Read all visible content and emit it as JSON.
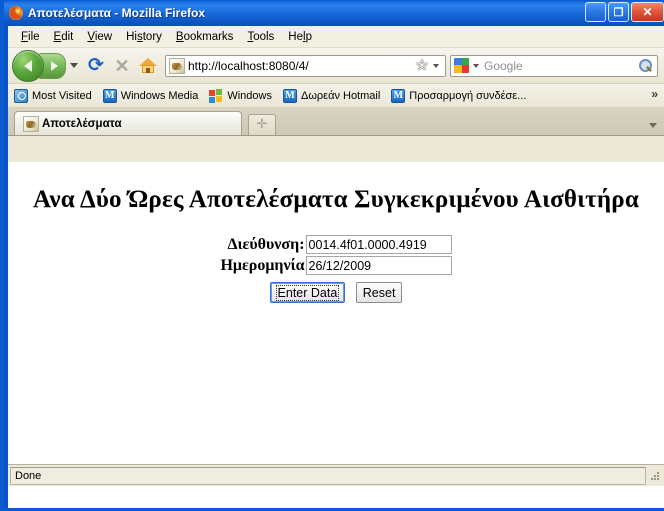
{
  "window": {
    "title": "Αποτελέσματα - Mozilla Firefox",
    "app_icon": "firefox-icon",
    "controls": {
      "minimize": "_",
      "maximize": "❐",
      "close": "✕"
    }
  },
  "menubar": {
    "items": [
      {
        "accel": "F",
        "rest": "ile"
      },
      {
        "accel": "E",
        "rest": "dit"
      },
      {
        "accel": "V",
        "rest": "iew"
      },
      {
        "pre": "Hi",
        "accel": "s",
        "rest": "tory"
      },
      {
        "accel": "B",
        "rest": "ookmarks"
      },
      {
        "accel": "T",
        "rest": "ools"
      },
      {
        "pre": "He",
        "accel": "l",
        "rest": "p"
      }
    ]
  },
  "navbar": {
    "back_tooltip": "Back",
    "forward_tooltip": "Forward",
    "reload_glyph": "⟳",
    "stop_glyph": "✕",
    "url": "http://localhost:8080/4/",
    "star_glyph": "☆",
    "search_placeholder": "Google"
  },
  "bookmarks": {
    "items": [
      {
        "label": "Most Visited",
        "icon": "most-visited-icon"
      },
      {
        "label": "Windows Media",
        "icon": "msn-icon"
      },
      {
        "label": "Windows",
        "icon": "windows-flag-icon"
      },
      {
        "label": "Δωρεάν Hotmail",
        "icon": "msn-icon"
      },
      {
        "label": "Προσαρμογή συνδέσε...",
        "icon": "msn-icon"
      }
    ],
    "overflow": "»"
  },
  "tabs": {
    "items": [
      {
        "label": "Αποτελέσματα",
        "favicon": "page-favicon"
      }
    ],
    "new_tab_glyph": "✛"
  },
  "page": {
    "heading": "Ανα Δύο Ώρες Αποτελέσματα Συγκεκριμένου Αισθιτήρα",
    "fields": [
      {
        "label": "Διεύθυνση:",
        "value": "0014.4f01.0000.4919"
      },
      {
        "label": "Ημερομηνία",
        "value": "26/12/2009"
      }
    ],
    "buttons": {
      "submit": "Enter Data",
      "reset": "Reset"
    }
  },
  "statusbar": {
    "text": "Done"
  }
}
